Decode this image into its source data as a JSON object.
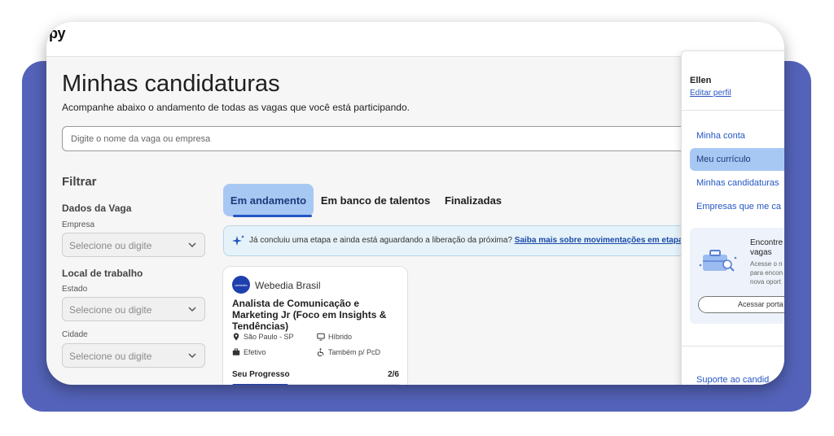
{
  "header": {
    "logo_text": "py"
  },
  "page": {
    "title": "Minhas candidaturas",
    "subtitle": "Acompanhe abaixo o andamento de todas as vagas que você está participando."
  },
  "search": {
    "placeholder": "Digite o nome da vaga ou empresa"
  },
  "filters": {
    "title": "Filtrar",
    "job_section": "Dados da Vaga",
    "company_label": "Empresa",
    "company_value": "Selecione ou digite",
    "location_section": "Local de trabalho",
    "state_label": "Estado",
    "state_value": "Selecione ou digite",
    "city_label": "Cidade",
    "city_value": "Selecione ou digite"
  },
  "tabs": [
    {
      "label": "Em andamento",
      "active": true
    },
    {
      "label": "Em banco de talentos",
      "active": false
    },
    {
      "label": "Finalizadas",
      "active": false
    }
  ],
  "info": {
    "text": "Já concluiu uma etapa e ainda está aguardando a liberação da próxima?",
    "link": "Saiba mais sobre movimentações em etapas"
  },
  "card": {
    "company_logo_text": "webedia",
    "company": "Webedia Brasil",
    "title": "Analista de Comunicação e Marketing Jr (Foco em Insights & Tendências)",
    "location": "São Paulo - SP",
    "mode": "Híbrido",
    "contract": "Efetivo",
    "accessibility": "Também p/ PcD",
    "progress_label": "Seu Progresso",
    "progress_count": "2/6",
    "progress_fraction": 0.333
  },
  "side_menu": {
    "user_name": "Ellen",
    "edit_profile": "Editar perfil",
    "items": [
      {
        "label": "Minha conta",
        "active": false
      },
      {
        "label": "Meu currículo",
        "active": true
      },
      {
        "label": "Minhas candidaturas",
        "active": false
      },
      {
        "label": "Empresas que me ca",
        "active": false
      }
    ],
    "promo_title_1": "Encontre",
    "promo_title_2": "vagas",
    "promo_desc_1": "Acesse o n",
    "promo_desc_2": "para encon",
    "promo_desc_3": "nova oport",
    "promo_button": "Acessar porta",
    "support": "Suporte ao candid"
  },
  "colors": {
    "background_frame": "#5463b9",
    "accent": "#2456c4",
    "tab_active": "#a8c8f4"
  }
}
